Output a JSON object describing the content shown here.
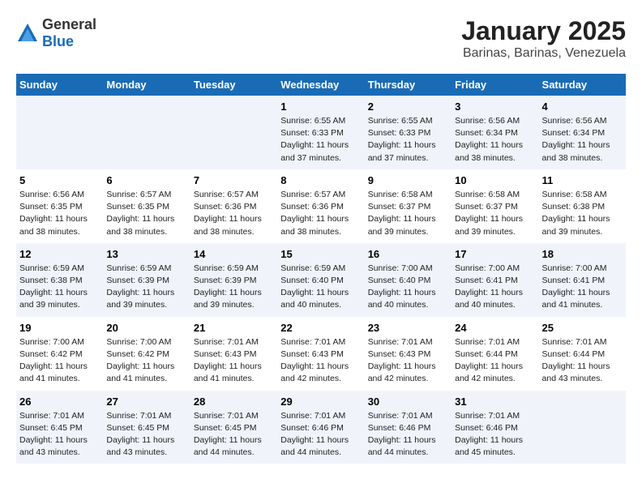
{
  "logo": {
    "general": "General",
    "blue": "Blue"
  },
  "title": "January 2025",
  "location": "Barinas, Barinas, Venezuela",
  "weekdays": [
    "Sunday",
    "Monday",
    "Tuesday",
    "Wednesday",
    "Thursday",
    "Friday",
    "Saturday"
  ],
  "weeks": [
    [
      {
        "day": "",
        "info": ""
      },
      {
        "day": "",
        "info": ""
      },
      {
        "day": "",
        "info": ""
      },
      {
        "day": "1",
        "info": "Sunrise: 6:55 AM\nSunset: 6:33 PM\nDaylight: 11 hours\nand 37 minutes."
      },
      {
        "day": "2",
        "info": "Sunrise: 6:55 AM\nSunset: 6:33 PM\nDaylight: 11 hours\nand 37 minutes."
      },
      {
        "day": "3",
        "info": "Sunrise: 6:56 AM\nSunset: 6:34 PM\nDaylight: 11 hours\nand 38 minutes."
      },
      {
        "day": "4",
        "info": "Sunrise: 6:56 AM\nSunset: 6:34 PM\nDaylight: 11 hours\nand 38 minutes."
      }
    ],
    [
      {
        "day": "5",
        "info": "Sunrise: 6:56 AM\nSunset: 6:35 PM\nDaylight: 11 hours\nand 38 minutes."
      },
      {
        "day": "6",
        "info": "Sunrise: 6:57 AM\nSunset: 6:35 PM\nDaylight: 11 hours\nand 38 minutes."
      },
      {
        "day": "7",
        "info": "Sunrise: 6:57 AM\nSunset: 6:36 PM\nDaylight: 11 hours\nand 38 minutes."
      },
      {
        "day": "8",
        "info": "Sunrise: 6:57 AM\nSunset: 6:36 PM\nDaylight: 11 hours\nand 38 minutes."
      },
      {
        "day": "9",
        "info": "Sunrise: 6:58 AM\nSunset: 6:37 PM\nDaylight: 11 hours\nand 39 minutes."
      },
      {
        "day": "10",
        "info": "Sunrise: 6:58 AM\nSunset: 6:37 PM\nDaylight: 11 hours\nand 39 minutes."
      },
      {
        "day": "11",
        "info": "Sunrise: 6:58 AM\nSunset: 6:38 PM\nDaylight: 11 hours\nand 39 minutes."
      }
    ],
    [
      {
        "day": "12",
        "info": "Sunrise: 6:59 AM\nSunset: 6:38 PM\nDaylight: 11 hours\nand 39 minutes."
      },
      {
        "day": "13",
        "info": "Sunrise: 6:59 AM\nSunset: 6:39 PM\nDaylight: 11 hours\nand 39 minutes."
      },
      {
        "day": "14",
        "info": "Sunrise: 6:59 AM\nSunset: 6:39 PM\nDaylight: 11 hours\nand 39 minutes."
      },
      {
        "day": "15",
        "info": "Sunrise: 6:59 AM\nSunset: 6:40 PM\nDaylight: 11 hours\nand 40 minutes."
      },
      {
        "day": "16",
        "info": "Sunrise: 7:00 AM\nSunset: 6:40 PM\nDaylight: 11 hours\nand 40 minutes."
      },
      {
        "day": "17",
        "info": "Sunrise: 7:00 AM\nSunset: 6:41 PM\nDaylight: 11 hours\nand 40 minutes."
      },
      {
        "day": "18",
        "info": "Sunrise: 7:00 AM\nSunset: 6:41 PM\nDaylight: 11 hours\nand 41 minutes."
      }
    ],
    [
      {
        "day": "19",
        "info": "Sunrise: 7:00 AM\nSunset: 6:42 PM\nDaylight: 11 hours\nand 41 minutes."
      },
      {
        "day": "20",
        "info": "Sunrise: 7:00 AM\nSunset: 6:42 PM\nDaylight: 11 hours\nand 41 minutes."
      },
      {
        "day": "21",
        "info": "Sunrise: 7:01 AM\nSunset: 6:43 PM\nDaylight: 11 hours\nand 41 minutes."
      },
      {
        "day": "22",
        "info": "Sunrise: 7:01 AM\nSunset: 6:43 PM\nDaylight: 11 hours\nand 42 minutes."
      },
      {
        "day": "23",
        "info": "Sunrise: 7:01 AM\nSunset: 6:43 PM\nDaylight: 11 hours\nand 42 minutes."
      },
      {
        "day": "24",
        "info": "Sunrise: 7:01 AM\nSunset: 6:44 PM\nDaylight: 11 hours\nand 42 minutes."
      },
      {
        "day": "25",
        "info": "Sunrise: 7:01 AM\nSunset: 6:44 PM\nDaylight: 11 hours\nand 43 minutes."
      }
    ],
    [
      {
        "day": "26",
        "info": "Sunrise: 7:01 AM\nSunset: 6:45 PM\nDaylight: 11 hours\nand 43 minutes."
      },
      {
        "day": "27",
        "info": "Sunrise: 7:01 AM\nSunset: 6:45 PM\nDaylight: 11 hours\nand 43 minutes."
      },
      {
        "day": "28",
        "info": "Sunrise: 7:01 AM\nSunset: 6:45 PM\nDaylight: 11 hours\nand 44 minutes."
      },
      {
        "day": "29",
        "info": "Sunrise: 7:01 AM\nSunset: 6:46 PM\nDaylight: 11 hours\nand 44 minutes."
      },
      {
        "day": "30",
        "info": "Sunrise: 7:01 AM\nSunset: 6:46 PM\nDaylight: 11 hours\nand 44 minutes."
      },
      {
        "day": "31",
        "info": "Sunrise: 7:01 AM\nSunset: 6:46 PM\nDaylight: 11 hours\nand 45 minutes."
      },
      {
        "day": "",
        "info": ""
      }
    ]
  ]
}
